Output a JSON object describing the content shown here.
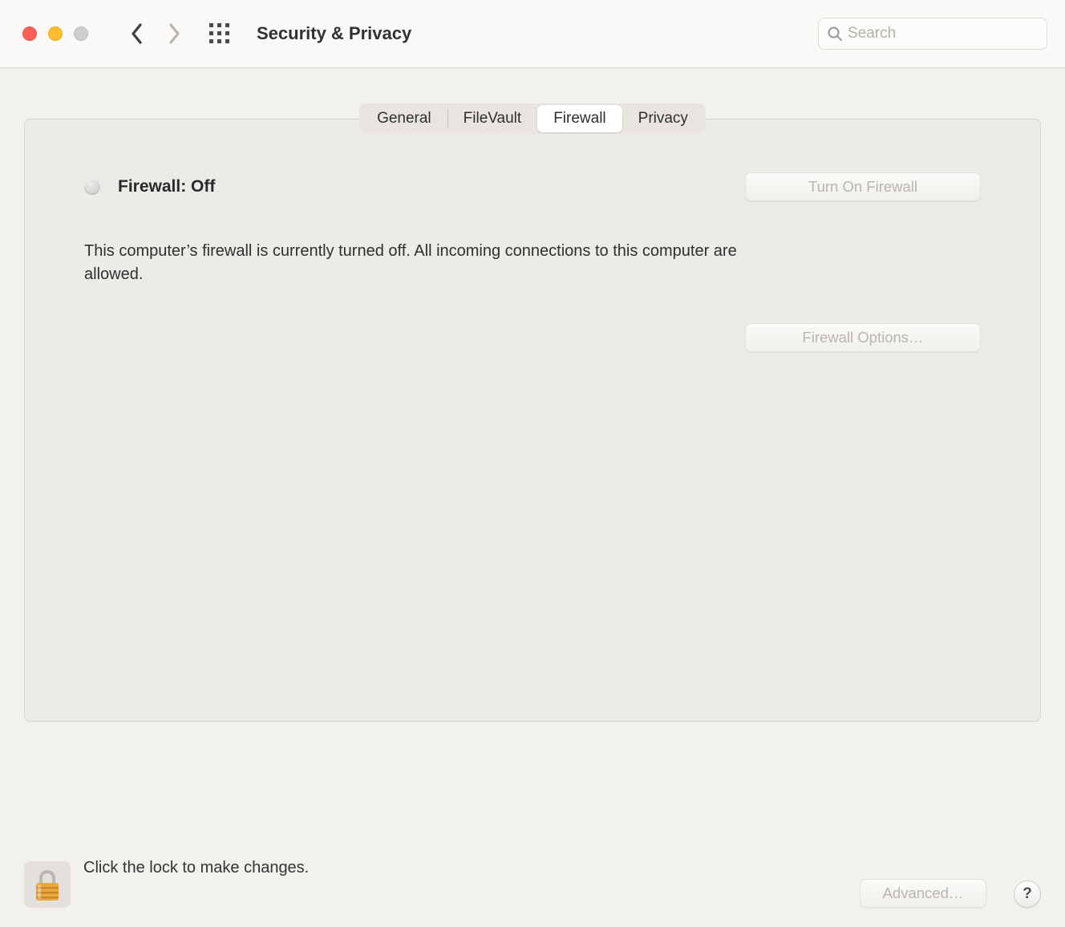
{
  "header": {
    "title": "Security & Privacy",
    "search_placeholder": "Search"
  },
  "tabs": {
    "general": "General",
    "filevault": "FileVault",
    "firewall": "Firewall",
    "privacy": "Privacy",
    "active": "firewall"
  },
  "firewall": {
    "status_label": "Firewall: Off",
    "turn_on_label": "Turn On Firewall",
    "description": "This computer’s firewall is currently turned off. All incoming connections to this computer are allowed.",
    "options_label": "Firewall Options…"
  },
  "footer": {
    "lock_hint": "Click the lock to make changes.",
    "advanced_label": "Advanced…",
    "help_label": "?"
  }
}
